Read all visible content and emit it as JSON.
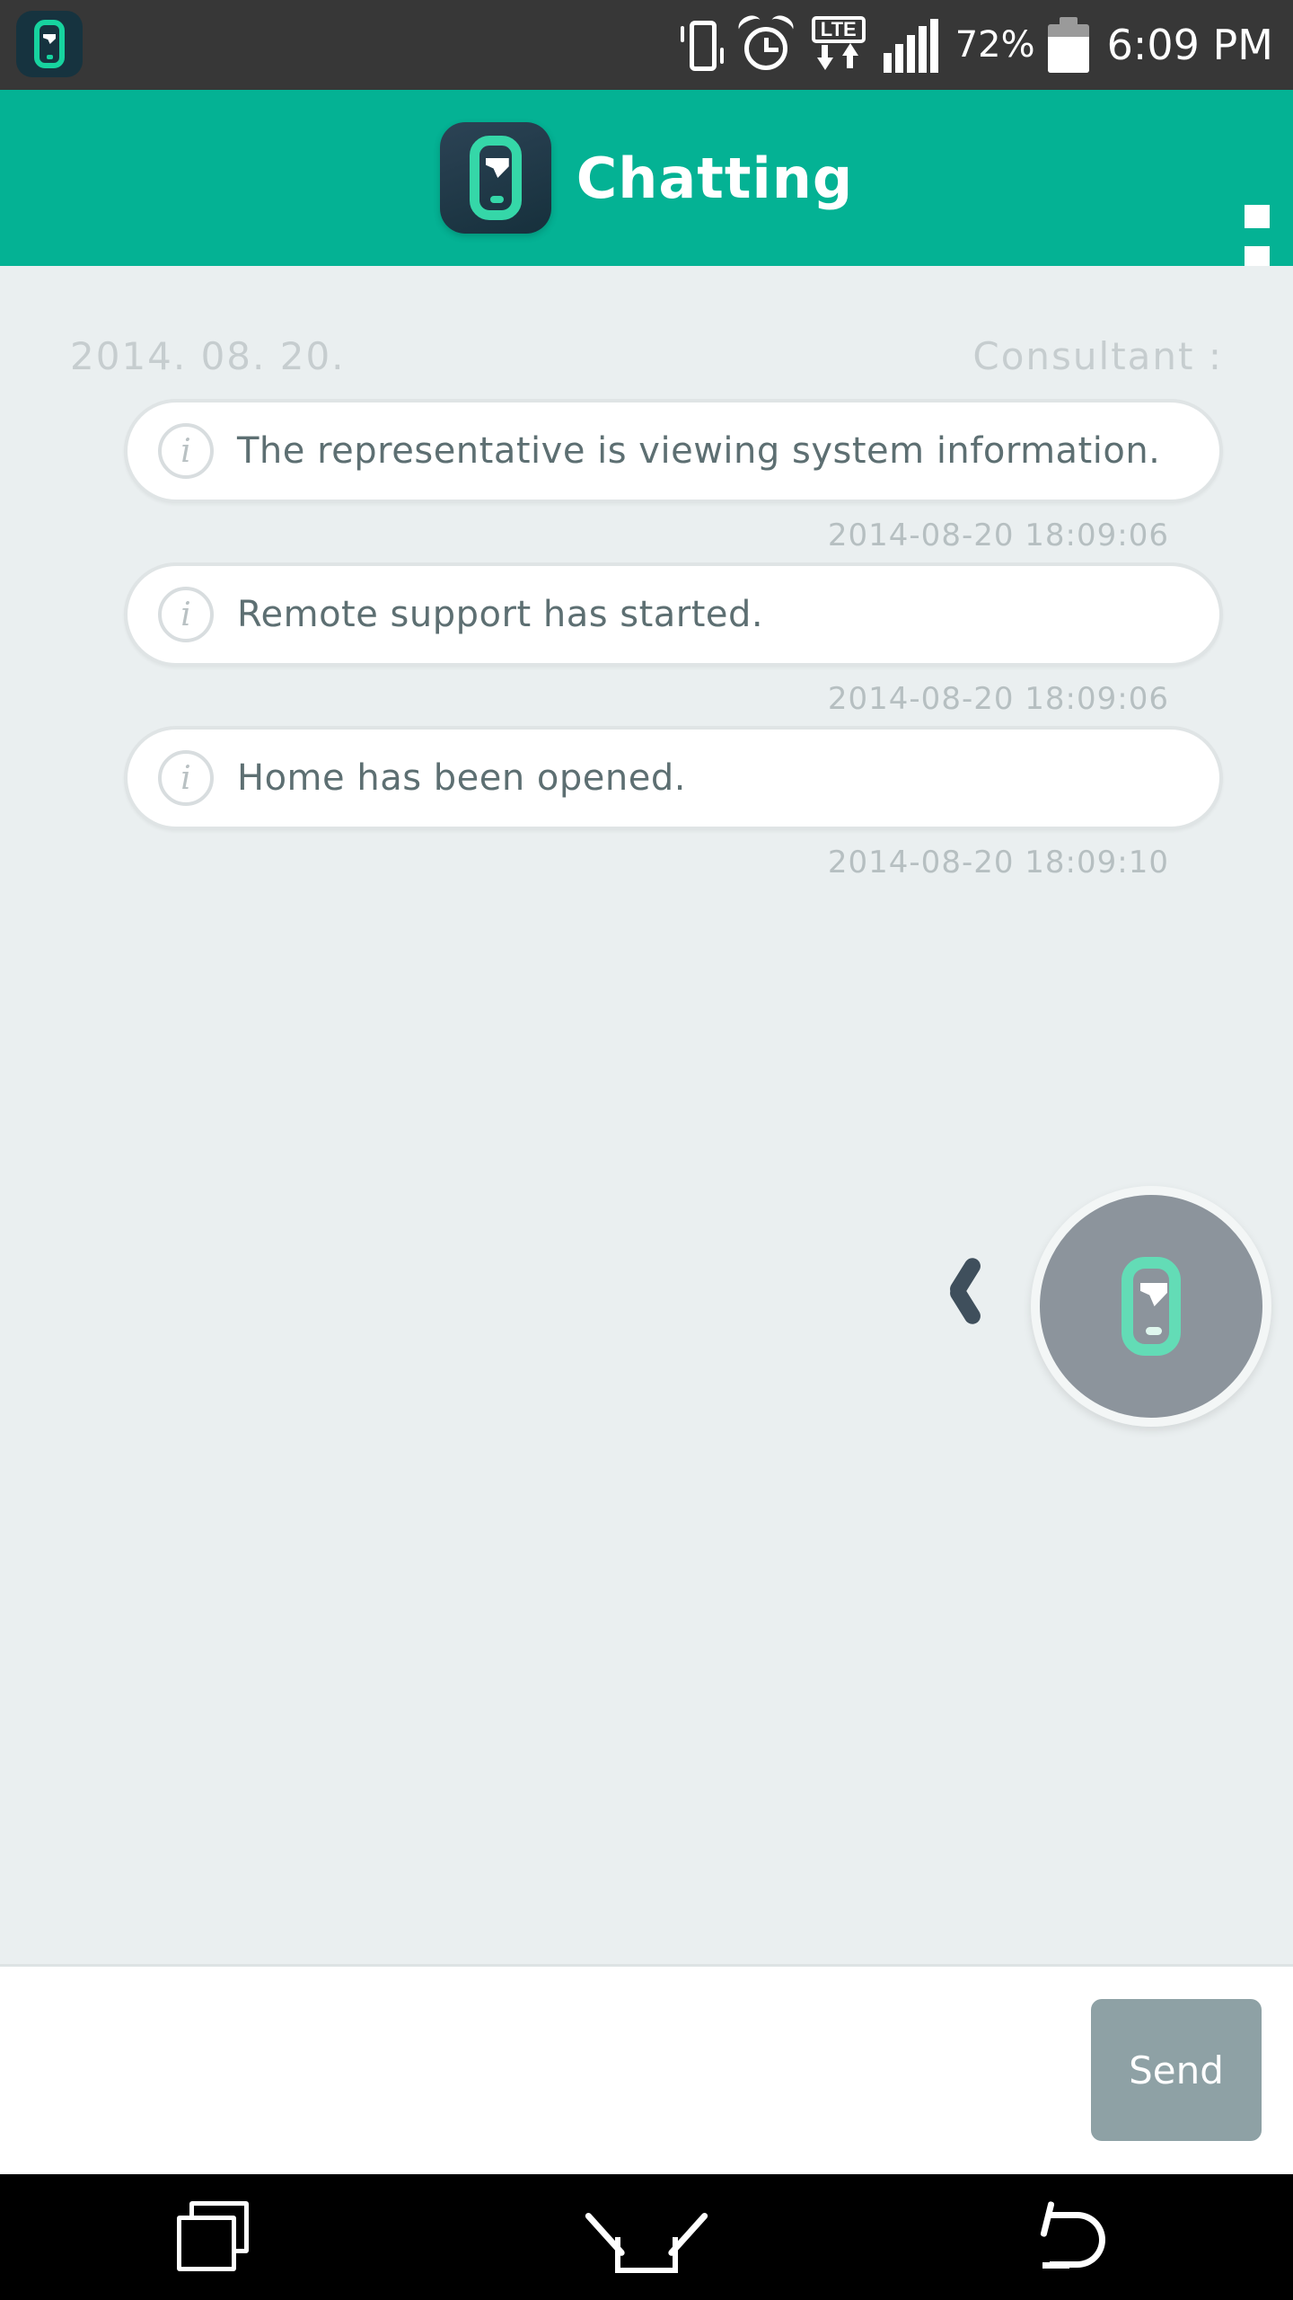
{
  "status_bar": {
    "app_icon": "app-phone-icon",
    "vibrate_icon": "vibrate-icon",
    "alarm_icon": "alarm-clock-icon",
    "network_label": "LTE",
    "network_icon": "lte-data-icon",
    "signal_icon": "signal-bars-icon",
    "battery_percent": "72%",
    "battery_icon": "battery-icon",
    "time": "6:09 PM",
    "background_color": "#373737"
  },
  "app_bar": {
    "title": "Chatting",
    "logo_icon": "chatting-app-logo-icon",
    "overflow_icon": "overflow-menu-icon",
    "background_color": "#04b294"
  },
  "chat": {
    "date_label": "2014. 08. 20.",
    "consultant_label": "Consultant :",
    "background_color": "#eaeff0",
    "messages": [
      {
        "icon": "info-icon",
        "text": "The representative is viewing system information.",
        "timestamp": "2014-08-20 18:09:06"
      },
      {
        "icon": "info-icon",
        "text": "Remote support has started.",
        "timestamp": "2014-08-20 18:09:06"
      },
      {
        "icon": "info-icon",
        "text": "Home has been opened.",
        "timestamp": "2014-08-20 18:09:10"
      }
    ]
  },
  "floating": {
    "chevron_icon": "chevron-left-icon",
    "bubble_icon": "remote-support-phone-icon",
    "bubble_color": "#8c949c"
  },
  "input_bar": {
    "placeholder": "",
    "value": "",
    "send_label": "Send",
    "send_color": "#8ea1a5"
  },
  "nav_bar": {
    "recents_icon": "recents-icon",
    "home_icon": "home-icon",
    "back_icon": "back-icon",
    "background_color": "#000000"
  }
}
